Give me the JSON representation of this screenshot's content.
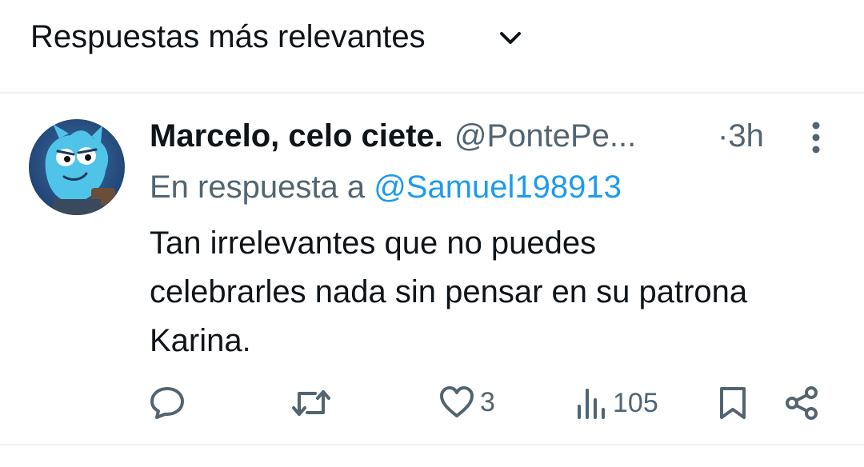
{
  "header": {
    "sort_label": "Respuestas más relevantes",
    "chevron_icon": "chevron-down-icon"
  },
  "tweet": {
    "author_name": "Marcelo, celo ciete.",
    "author_handle": "@PontePe...",
    "separator": "·",
    "time": "3h",
    "reply_prefix": "En respuesta a",
    "reply_handle": "@Samuel198913",
    "text_lines": [
      "Tan irrelevantes que no puedes",
      "celebrarles nada sin pensar en su patrona",
      "Karina."
    ],
    "actions": {
      "reply_icon": "reply-icon",
      "retweet_icon": "retweet-icon",
      "like_icon": "heart-icon",
      "like_count": "3",
      "views_icon": "views-icon",
      "views_count": "105",
      "bookmark_icon": "bookmark-icon",
      "share_icon": "share-icon"
    }
  },
  "colors": {
    "text_primary": "#0f1419",
    "text_secondary": "#536471",
    "link": "#1d9bf0",
    "divider": "#eff3f4"
  }
}
